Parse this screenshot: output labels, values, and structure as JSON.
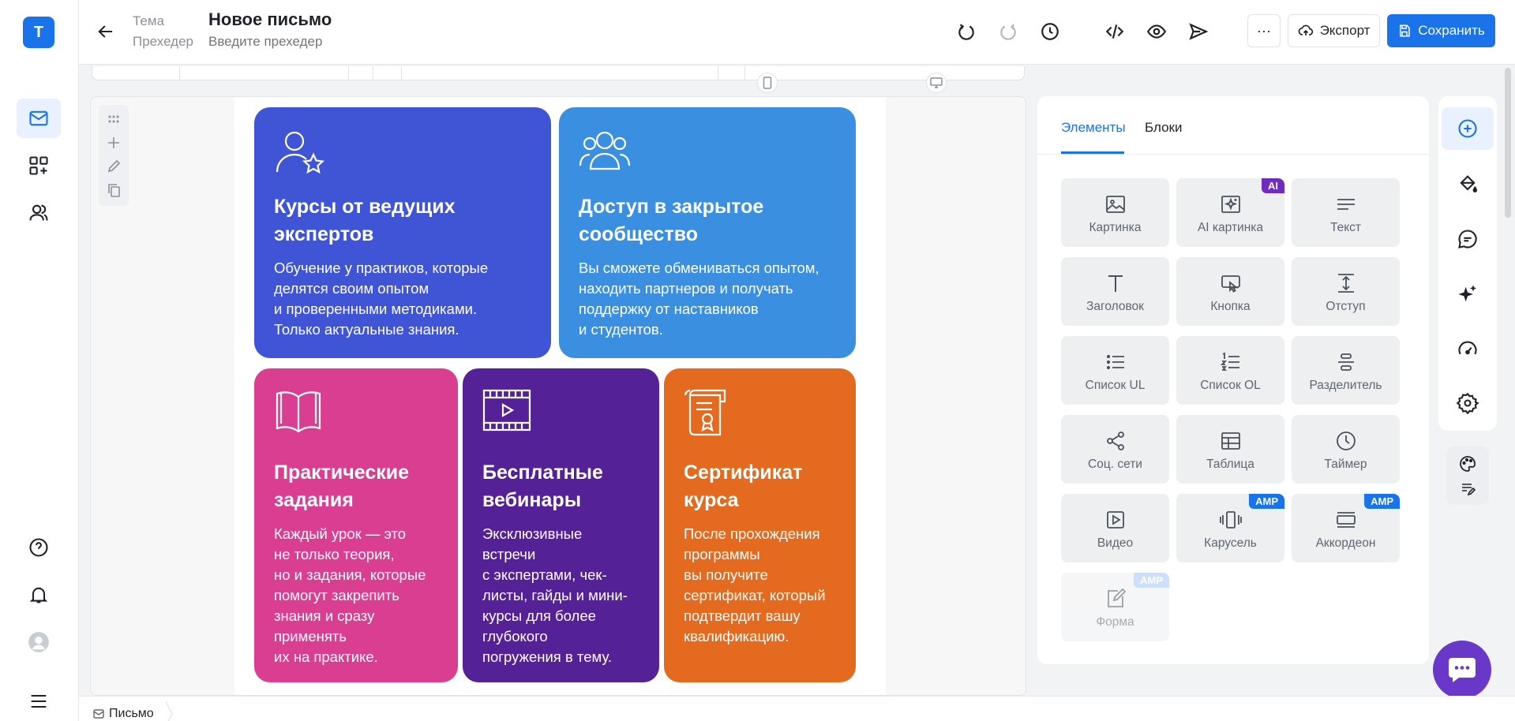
{
  "app": {
    "logo_letter": "Т",
    "accent": "#1a73e8"
  },
  "header": {
    "theme_label": "Тема",
    "preheader_label": "Прехедер",
    "title": "Новое письмо",
    "preheader_placeholder": "Введите прехедер",
    "more_label": "···",
    "export_label": "Экспорт",
    "save_label": "Сохранить"
  },
  "cards": [
    {
      "title": "Курсы от ведущих экспертов",
      "text": "Обучение у практиков, которые\nделятся своим опытом\nи проверенными методиками.\nТолько актуальные знания.",
      "color": "#3f55d6"
    },
    {
      "title": "Доступ в закрытое сообщество",
      "text": "Вы сможете обмениваться опытом,\nнаходить партнеров и получать\nподдержку от наставников\nи студентов.",
      "color": "#3a8fe0"
    },
    {
      "title": "Практические задания",
      "text": "Каждый урок — это\nне только теория,\nно и задания, которые\nпомогут закрепить\nзнания и сразу\nприменять\nих на практике.",
      "color": "#d93e90"
    },
    {
      "title": "Бесплатные вебинары",
      "text": "Эксклюзивные\nвстречи\nс экспертами, чек-\nлисты, гайды и мини-\nкурсы для более\nглубокого\nпогружения в тему.",
      "color": "#552196"
    },
    {
      "title": "Сертификат курса",
      "text": "После прохождения\nпрограммы\nвы получите\nсертификат, который\nподтвердит вашу\nквалификацию.",
      "color": "#e36a1f"
    }
  ],
  "panel": {
    "tabs": [
      "Элементы",
      "Блоки"
    ],
    "active_tab": "Элементы",
    "tiles": [
      {
        "label": "Картинка",
        "icon": "image-icon"
      },
      {
        "label": "AI картинка",
        "icon": "ai-image-icon",
        "badge": "AI"
      },
      {
        "label": "Текст",
        "icon": "text-icon"
      },
      {
        "label": "Заголовок",
        "icon": "heading-icon"
      },
      {
        "label": "Кнопка",
        "icon": "button-icon"
      },
      {
        "label": "Отступ",
        "icon": "spacer-icon"
      },
      {
        "label": "Список UL",
        "icon": "list-ul-icon"
      },
      {
        "label": "Список OL",
        "icon": "list-ol-icon"
      },
      {
        "label": "Разделитель",
        "icon": "divider-icon"
      },
      {
        "label": "Соц. сети",
        "icon": "share-icon"
      },
      {
        "label": "Таблица",
        "icon": "table-icon"
      },
      {
        "label": "Таймер",
        "icon": "clock-icon"
      },
      {
        "label": "Видео",
        "icon": "video-icon"
      },
      {
        "label": "Карусель",
        "icon": "carousel-icon",
        "badge": "AMP"
      },
      {
        "label": "Аккордеон",
        "icon": "accordion-icon",
        "badge": "AMP"
      },
      {
        "label": "Форма",
        "icon": "form-icon",
        "badge": "AMP",
        "disabled": true
      }
    ]
  },
  "footer": {
    "breadcrumb": "Письмо"
  }
}
